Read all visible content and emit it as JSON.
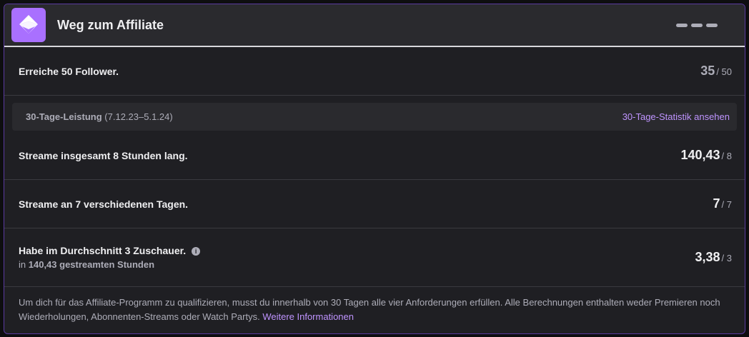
{
  "header": {
    "title": "Weg zum Affiliate",
    "badge_icon": "affiliate-badge-icon",
    "menu_icon": "drag-handle-icon"
  },
  "requirements": {
    "followers": {
      "label": "Erreiche 50 Follower.",
      "value": "35",
      "goal": "/ 50"
    },
    "stats_bar": {
      "label": "30-Tage-Leistung",
      "range": "(7.12.23–5.1.24)",
      "link": "30-Tage-Statistik ansehen"
    },
    "hours": {
      "label": "Streame insgesamt 8 Stunden lang.",
      "value": "140,43",
      "goal": "/ 8"
    },
    "days": {
      "label": "Streame an 7 verschiedenen Tagen.",
      "value": "7",
      "goal": "/ 7"
    },
    "viewers": {
      "label": "Habe im Durchschnitt 3 Zuschauer.",
      "info_icon": "info-icon",
      "sub_prefix": "in",
      "sub_bold": "140,43 gestreamten Stunden",
      "value": "3,38",
      "goal": "/ 3"
    }
  },
  "footer": {
    "text": "Um dich für das Affiliate-Programm zu qualifizieren, musst du innerhalb von 30 Tagen alle vier Anforderungen erfüllen. Alle Berechnungen enthalten weder Premieren noch Wiederholungen, Abonnenten-Streams oder Watch Partys.",
    "link": "Weitere Informationen"
  },
  "colors": {
    "accent": "#a970ff",
    "link": "#bf94ff",
    "background": "#1f1f23"
  }
}
